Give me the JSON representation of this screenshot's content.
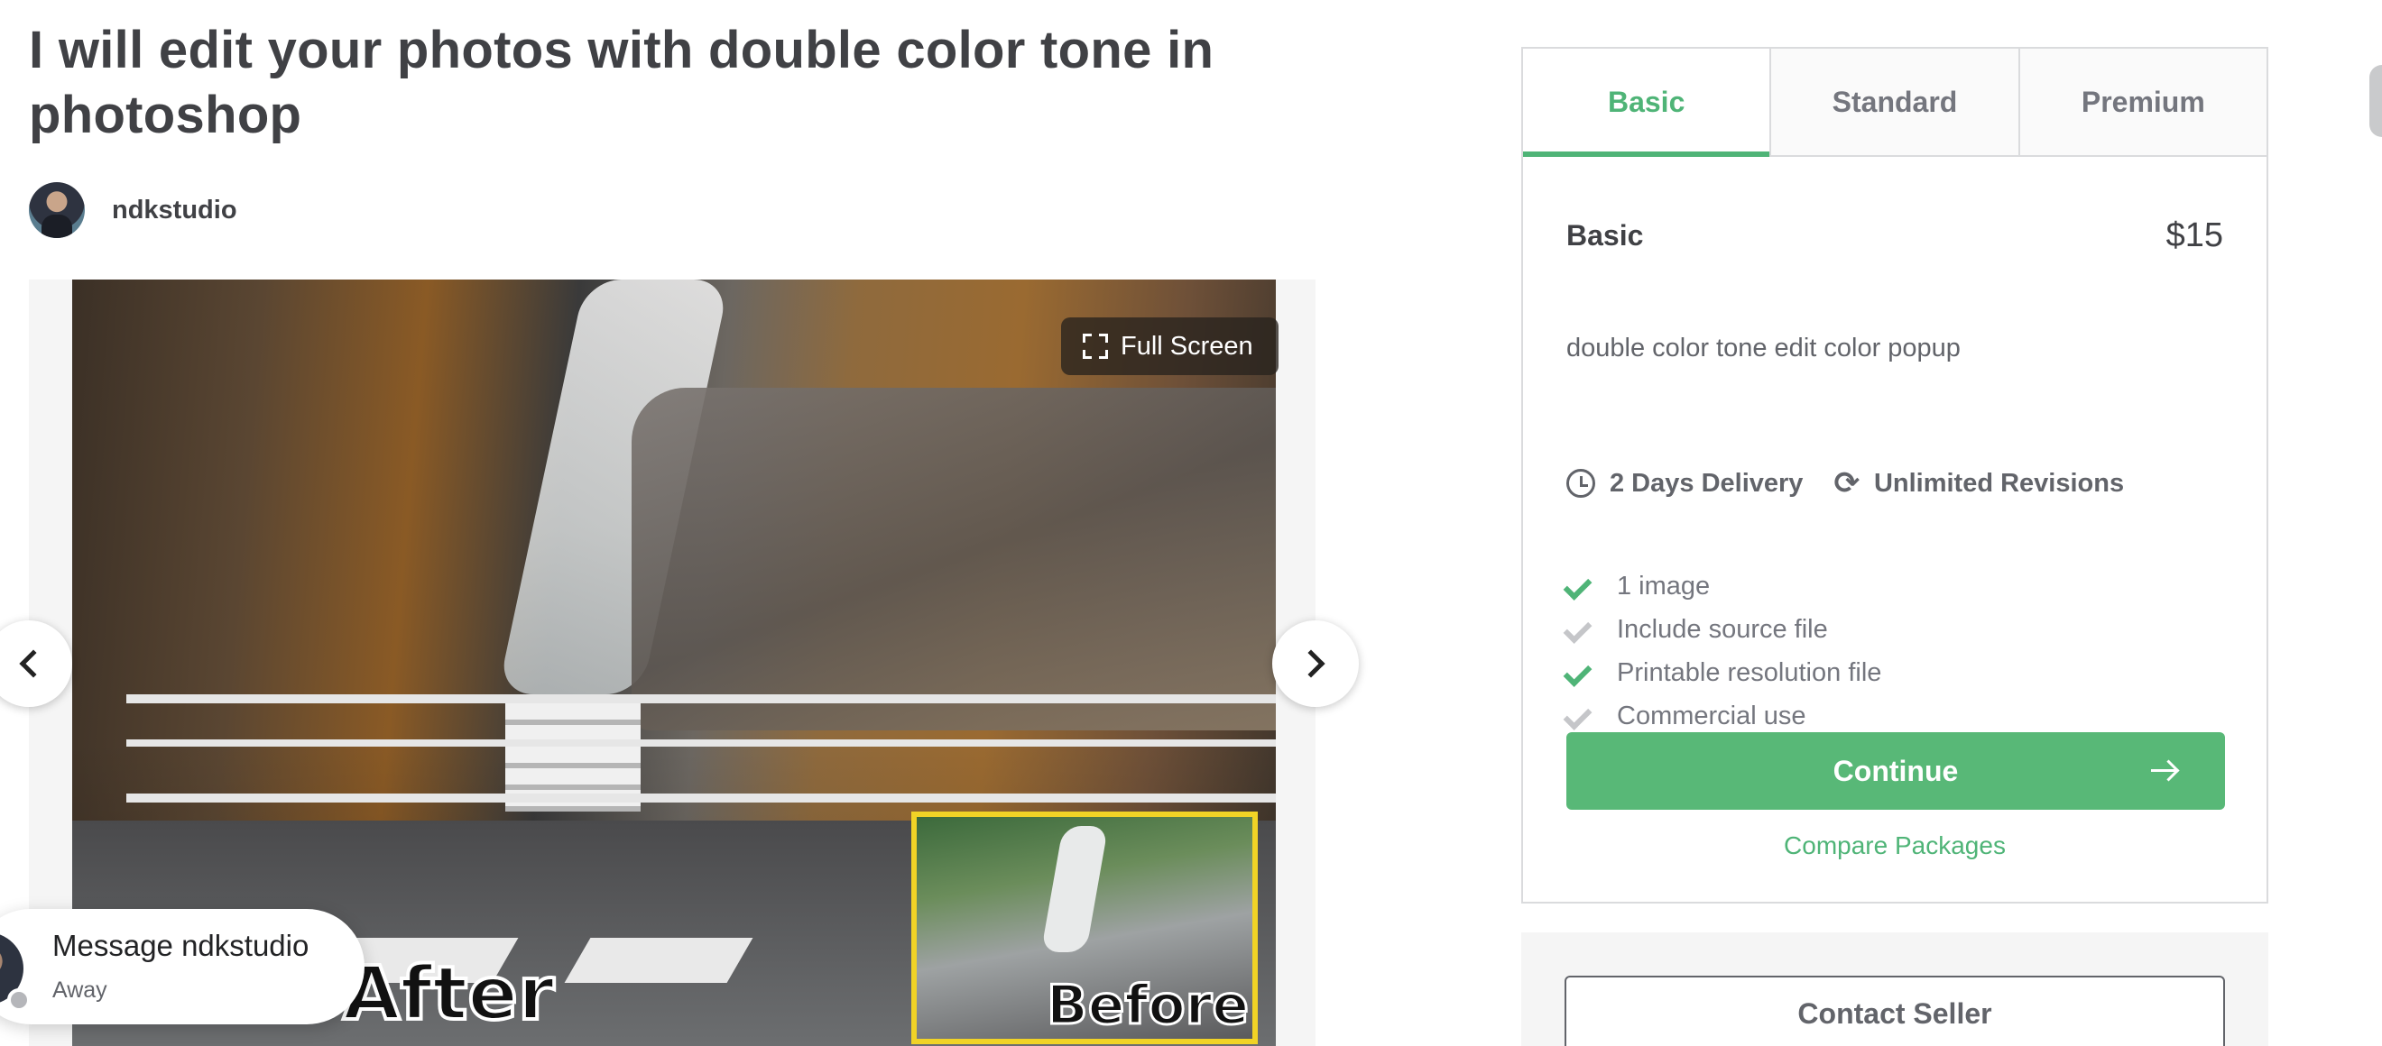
{
  "gig": {
    "title": "I will edit your photos with double color tone in photoshop",
    "seller_name": "ndkstudio"
  },
  "gallery": {
    "fullscreen_label": "Full Screen",
    "overlay_after": "After",
    "overlay_before": "Before"
  },
  "message": {
    "title": "Message ndkstudio",
    "status": "Away"
  },
  "packages": {
    "tabs": [
      "Basic",
      "Standard",
      "Premium"
    ],
    "active_tab": "Basic",
    "name": "Basic",
    "price": "$15",
    "description": "double color tone edit color popup",
    "delivery": "2 Days Delivery",
    "revisions": "Unlimited Revisions",
    "features": [
      {
        "label": "1 image",
        "included": true
      },
      {
        "label": "Include source file",
        "included": false
      },
      {
        "label": "Printable resolution file",
        "included": true
      },
      {
        "label": "Commercial use",
        "included": false
      }
    ],
    "continue_label": "Continue",
    "compare_label": "Compare Packages",
    "contact_label": "Contact Seller"
  },
  "colors": {
    "accent": "#4fb477",
    "button": "#58b877",
    "text": "#404145"
  }
}
